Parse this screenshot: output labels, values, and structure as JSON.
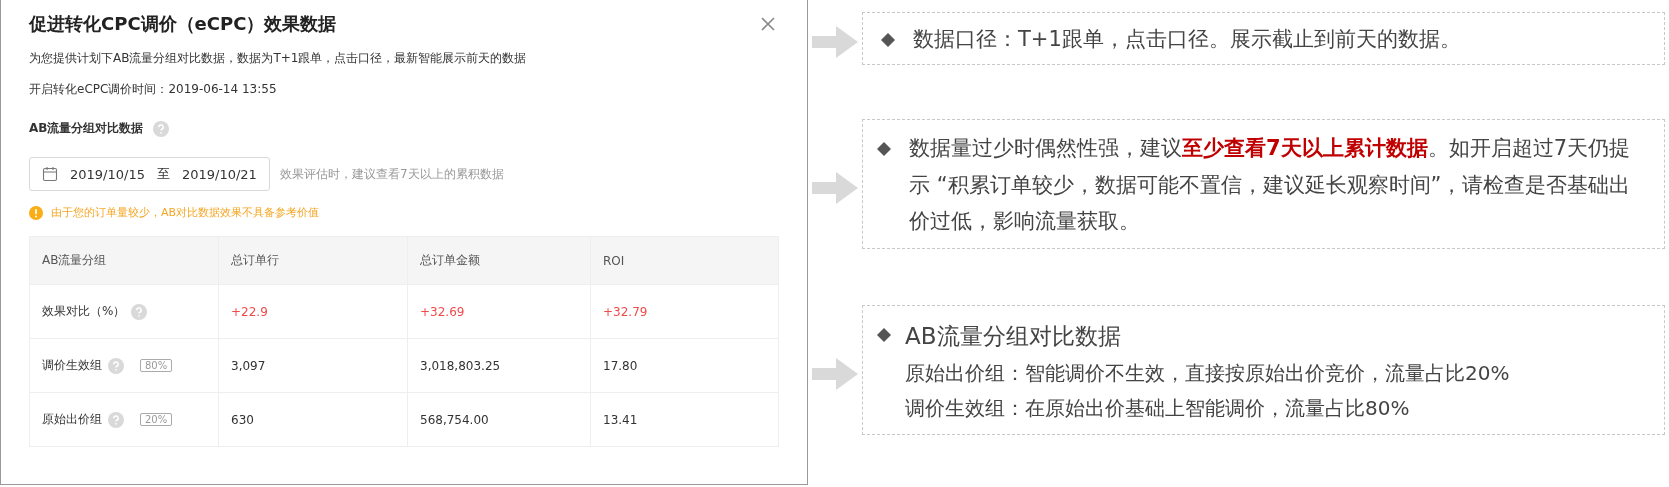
{
  "dialog": {
    "title": "促进转化CPC调价（eCPC）效果数据",
    "description": "为您提供计划下AB流量分组对比数据，数据为T+1跟单，点击口径，最新智能展示前天的数据",
    "start_time": "开启转化eCPC调价时间：2019-06-14 13:55",
    "section_title": "AB流量分组对比数据",
    "date_range": {
      "start": "2019/10/15",
      "separator": "至",
      "end": "2019/10/21"
    },
    "date_hint": "效果评估时，建议查看7天以上的累积数据",
    "warning": "由于您的订单量较少，AB对比数据效果不具备参考价值",
    "table": {
      "columns": [
        "AB流量分组",
        "总订单行",
        "总订单金额",
        "ROI"
      ],
      "rows": [
        {
          "kind": "comparison",
          "cells": [
            "效果对比（%）",
            "+22.9",
            "+32.69",
            "+32.79"
          ]
        },
        {
          "kind": "group",
          "tag": "80%",
          "cells": [
            "调价生效组",
            "3,097",
            "3,018,803.25",
            "17.80"
          ]
        },
        {
          "kind": "group",
          "tag": "20%",
          "cells": [
            "原始出价组",
            "630",
            "568,754.00",
            "13.41"
          ]
        }
      ]
    }
  },
  "notes": [
    {
      "kind": "bullet",
      "text": "数据口径：T+1跟单，点击口径。展示截止到前天的数据。"
    },
    {
      "kind": "bullet",
      "text": "数据量过少时偶然性强，建议**至少查看7天以上累计数据**。如开启超过7天仍提示 “积累订单较少，数据可能不置信，建议延长观察时间”，请检查是否基础出价过低，影响流量获取。"
    },
    {
      "kind": "heading",
      "text": "AB流量分组对比数据",
      "lines": [
        "原始出价组：智能调价不生效，直接按原始出价竞价，流量占比20%",
        "调价生效组：在原始出价基础上智能调价，流量占比80%"
      ]
    }
  ]
}
